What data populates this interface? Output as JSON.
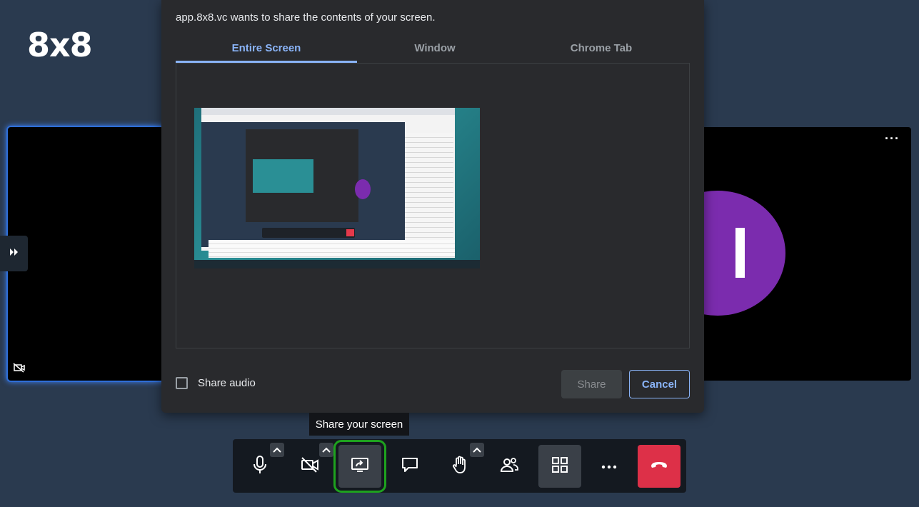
{
  "brand": {
    "logo_text": "8x8"
  },
  "dialog": {
    "title": "app.8x8.vc wants to share the contents of your screen.",
    "tabs": [
      {
        "label": "Entire Screen",
        "active": true
      },
      {
        "label": "Window",
        "active": false
      },
      {
        "label": "Chrome Tab",
        "active": false
      }
    ],
    "share_audio_label": "Share audio",
    "share_audio_checked": false,
    "share_button": "Share",
    "cancel_button": "Cancel"
  },
  "tooltip": {
    "text": "Share your screen"
  },
  "participants": {
    "right_tile_menu": "···"
  },
  "toolbar": {
    "buttons": [
      {
        "name": "microphone",
        "icon": "microphone-icon",
        "has_caret": true
      },
      {
        "name": "camera",
        "icon": "camera-off-icon",
        "has_caret": true
      },
      {
        "name": "screen-share",
        "icon": "screen-share-icon",
        "active": true
      },
      {
        "name": "chat",
        "icon": "chat-icon"
      },
      {
        "name": "raise-hand",
        "icon": "hand-icon",
        "has_caret": true
      },
      {
        "name": "participants",
        "icon": "participants-icon"
      },
      {
        "name": "tile-view",
        "icon": "grid-icon",
        "active": true
      },
      {
        "name": "more",
        "icon": "more-icon"
      },
      {
        "name": "hangup",
        "icon": "phone-hangup-icon"
      }
    ]
  },
  "colors": {
    "background": "#2a3a4f",
    "dialog": "#292a2d",
    "accent": "#8ab4f8",
    "hangup": "#dd3048",
    "avatar": "#7b2cae",
    "highlight_frame": "#1ea21e"
  }
}
